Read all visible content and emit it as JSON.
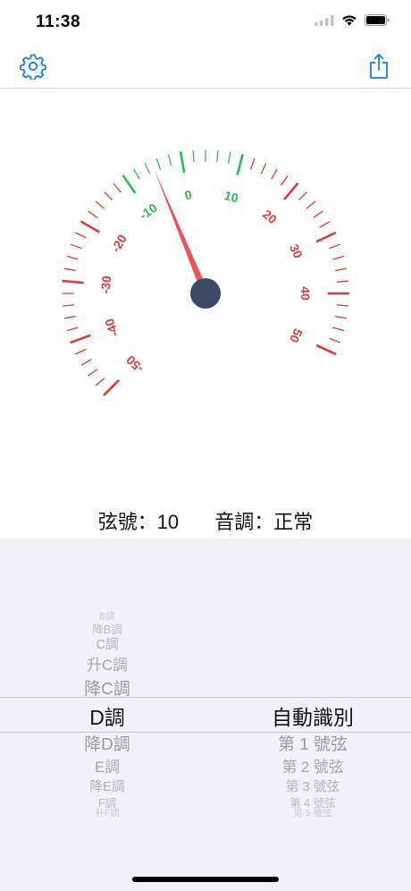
{
  "status_bar": {
    "time": "11:38"
  },
  "nav": {
    "left_icon": "gear-icon",
    "right_icon": "share-icon",
    "accent": "#1a7cf0"
  },
  "gauge": {
    "value": -5,
    "min": -50,
    "max": 50,
    "tick_labels": [
      "-50",
      "-40",
      "-30",
      "-20",
      "-10",
      "0",
      "10",
      "20",
      "30",
      "40",
      "50"
    ],
    "colors": {
      "in_tune": "#2bbf4a",
      "out_of_tune": "#e03a3a",
      "needle": "#e8545a",
      "hub": "#3b4a64"
    }
  },
  "readout": {
    "string_label": "弦號：10",
    "tone_label": "音調：正常"
  },
  "picker": {
    "left_items": [
      "升F調",
      "F調",
      "降E調",
      "E調",
      "降D調",
      "D調",
      "降C調",
      "升C調",
      "C調",
      "降B調",
      "B調"
    ],
    "left_selected": "D調",
    "right_items": [
      "第 1 號弦",
      "第 2 號弦",
      "第 3 號弦",
      "第 4 號弦",
      "第 5 號弦"
    ],
    "right_selected": "自動識別"
  }
}
